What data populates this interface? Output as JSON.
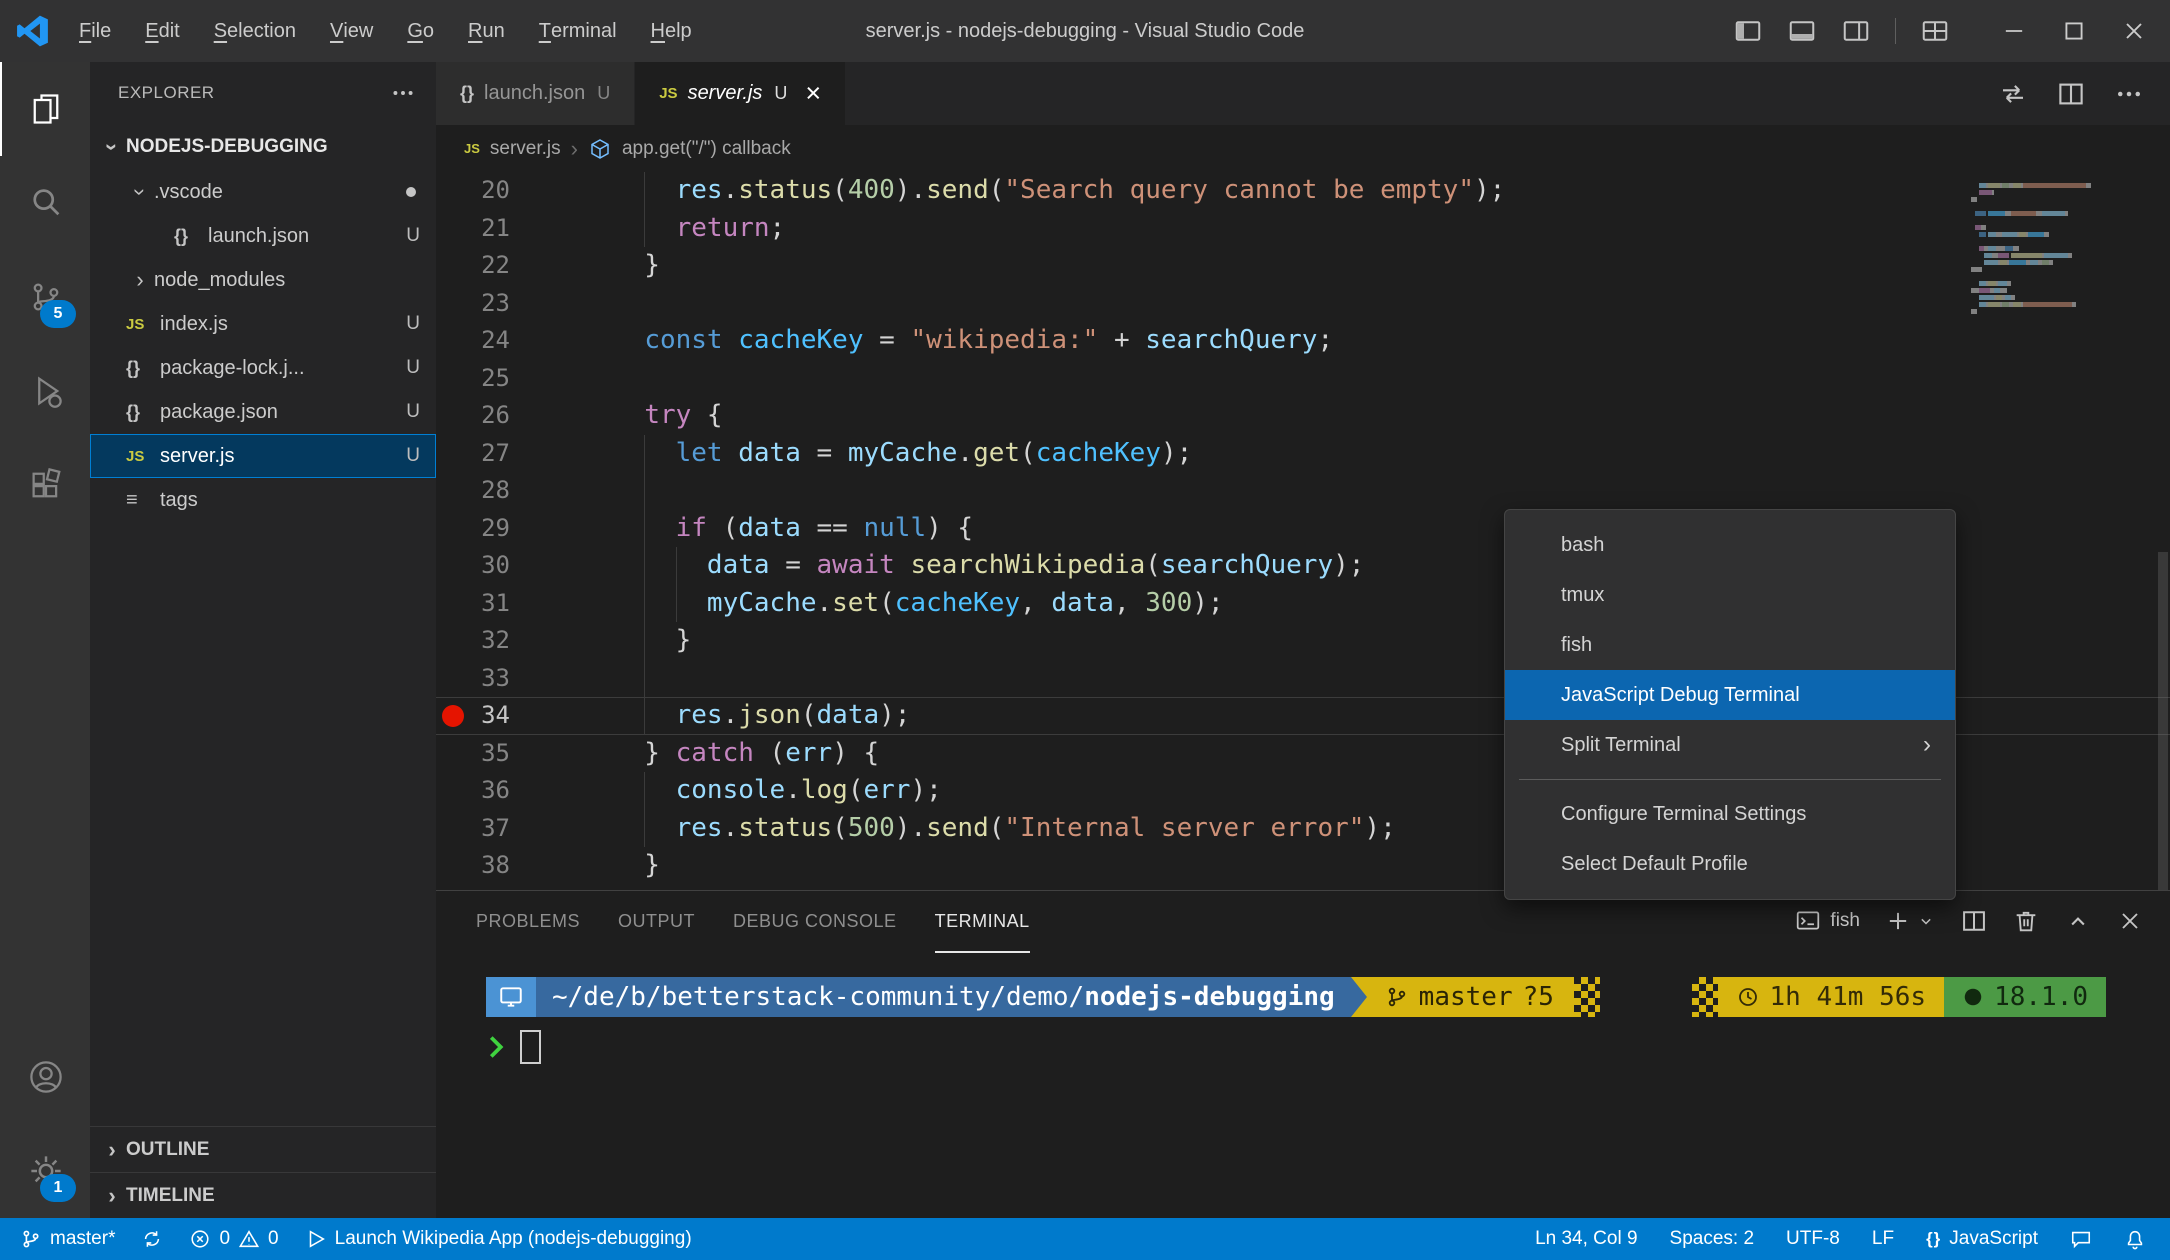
{
  "window": {
    "title": "server.js - nodejs-debugging - Visual Studio Code",
    "menus": [
      "File",
      "Edit",
      "Selection",
      "View",
      "Go",
      "Run",
      "Terminal",
      "Help"
    ]
  },
  "activity_bar": {
    "scm_badge": "5",
    "settings_badge": "1"
  },
  "sidebar": {
    "header": "EXPLORER",
    "root_label": "NODEJS-DEBUGGING",
    "files": [
      {
        "label": ".vscode",
        "kind": "folder",
        "chevron": "down",
        "indent": 1,
        "dot": true
      },
      {
        "label": "launch.json",
        "kind": "file",
        "icon": "json",
        "badge": "U",
        "indent": 2
      },
      {
        "label": "node_modules",
        "kind": "folder",
        "chevron": "right",
        "indent": 1
      },
      {
        "label": "index.js",
        "kind": "file",
        "icon": "js",
        "badge": "U",
        "indent": 1
      },
      {
        "label": "package-lock.j...",
        "kind": "file",
        "icon": "json",
        "badge": "U",
        "indent": 1
      },
      {
        "label": "package.json",
        "kind": "file",
        "icon": "json",
        "badge": "U",
        "indent": 1
      },
      {
        "label": "server.js",
        "kind": "file",
        "icon": "js",
        "badge": "U",
        "indent": 1,
        "selected": true
      },
      {
        "label": "tags",
        "kind": "file",
        "icon": "list",
        "indent": 1
      }
    ],
    "sections": [
      "OUTLINE",
      "TIMELINE"
    ]
  },
  "editor_tabs": [
    {
      "label": "launch.json",
      "icon": "json",
      "badge": "U",
      "active": false,
      "close": false,
      "italic": false
    },
    {
      "label": "server.js",
      "icon": "js",
      "badge": "U",
      "active": true,
      "close": true,
      "italic": true
    }
  ],
  "breadcrumb": {
    "file": "server.js",
    "symbol": "app.get(\"/\") callback"
  },
  "code": {
    "lines": [
      {
        "n": 20,
        "t": [
          [
            "p",
            "    "
          ],
          [
            "v",
            "res"
          ],
          [
            "p",
            "."
          ],
          [
            "f",
            "status"
          ],
          [
            "p",
            "("
          ],
          [
            "n",
            "400"
          ],
          [
            "p",
            ")."
          ],
          [
            "f",
            "send"
          ],
          [
            "p",
            "("
          ],
          [
            "s",
            "\"Search query cannot be empty\""
          ],
          [
            "p",
            ");"
          ]
        ]
      },
      {
        "n": 21,
        "t": [
          [
            "p",
            "    "
          ],
          [
            "k",
            "return"
          ],
          [
            "p",
            ";"
          ]
        ]
      },
      {
        "n": 22,
        "t": [
          [
            "p",
            "  }"
          ]
        ]
      },
      {
        "n": 23,
        "t": [
          [
            "p",
            "  "
          ]
        ]
      },
      {
        "n": 24,
        "t": [
          [
            "p",
            "  "
          ],
          [
            "d",
            "const"
          ],
          [
            "p",
            " "
          ],
          [
            "cv",
            "cacheKey"
          ],
          [
            "p",
            " = "
          ],
          [
            "s",
            "\"wikipedia:\""
          ],
          [
            "p",
            " + "
          ],
          [
            "v",
            "searchQuery"
          ],
          [
            "p",
            ";"
          ]
        ]
      },
      {
        "n": 25,
        "t": [
          [
            "p",
            "  "
          ]
        ]
      },
      {
        "n": 26,
        "t": [
          [
            "p",
            "  "
          ],
          [
            "k",
            "try"
          ],
          [
            "p",
            " {"
          ]
        ]
      },
      {
        "n": 27,
        "t": [
          [
            "p",
            "    "
          ],
          [
            "d",
            "let"
          ],
          [
            "p",
            " "
          ],
          [
            "v",
            "data"
          ],
          [
            "p",
            " = "
          ],
          [
            "v",
            "myCache"
          ],
          [
            "p",
            "."
          ],
          [
            "f",
            "get"
          ],
          [
            "p",
            "("
          ],
          [
            "cv",
            "cacheKey"
          ],
          [
            "p",
            ");"
          ]
        ]
      },
      {
        "n": 28,
        "t": [
          [
            "p",
            "    "
          ]
        ]
      },
      {
        "n": 29,
        "t": [
          [
            "p",
            "    "
          ],
          [
            "k",
            "if"
          ],
          [
            "p",
            " ("
          ],
          [
            "v",
            "data"
          ],
          [
            "p",
            " == "
          ],
          [
            "d",
            "null"
          ],
          [
            "p",
            ") {"
          ]
        ]
      },
      {
        "n": 30,
        "t": [
          [
            "p",
            "      "
          ],
          [
            "v",
            "data"
          ],
          [
            "p",
            " = "
          ],
          [
            "k",
            "await"
          ],
          [
            "p",
            " "
          ],
          [
            "f",
            "searchWikipedia"
          ],
          [
            "p",
            "("
          ],
          [
            "v",
            "searchQuery"
          ],
          [
            "p",
            ");"
          ]
        ]
      },
      {
        "n": 31,
        "t": [
          [
            "p",
            "      "
          ],
          [
            "v",
            "myCache"
          ],
          [
            "p",
            "."
          ],
          [
            "f",
            "set"
          ],
          [
            "p",
            "("
          ],
          [
            "cv",
            "cacheKey"
          ],
          [
            "p",
            ", "
          ],
          [
            "v",
            "data"
          ],
          [
            "p",
            ", "
          ],
          [
            "n",
            "300"
          ],
          [
            "p",
            ");"
          ]
        ]
      },
      {
        "n": 32,
        "t": [
          [
            "p",
            "    }"
          ]
        ]
      },
      {
        "n": 33,
        "t": [
          [
            "p",
            "    "
          ]
        ]
      },
      {
        "n": 34,
        "bp": true,
        "current": true,
        "t": [
          [
            "p",
            "    "
          ],
          [
            "v",
            "res"
          ],
          [
            "p",
            "."
          ],
          [
            "f",
            "json"
          ],
          [
            "p",
            "("
          ],
          [
            "v",
            "data"
          ],
          [
            "p",
            ");"
          ]
        ]
      },
      {
        "n": 35,
        "t": [
          [
            "p",
            "  } "
          ],
          [
            "k",
            "catch"
          ],
          [
            "p",
            " ("
          ],
          [
            "v",
            "err"
          ],
          [
            "p",
            ") {"
          ]
        ]
      },
      {
        "n": 36,
        "t": [
          [
            "p",
            "    "
          ],
          [
            "v",
            "console"
          ],
          [
            "p",
            "."
          ],
          [
            "f",
            "log"
          ],
          [
            "p",
            "("
          ],
          [
            "v",
            "err"
          ],
          [
            "p",
            ");"
          ]
        ]
      },
      {
        "n": 37,
        "t": [
          [
            "p",
            "    "
          ],
          [
            "v",
            "res"
          ],
          [
            "p",
            "."
          ],
          [
            "f",
            "status"
          ],
          [
            "p",
            "("
          ],
          [
            "n",
            "500"
          ],
          [
            "p",
            ")."
          ],
          [
            "f",
            "send"
          ],
          [
            "p",
            "("
          ],
          [
            "s",
            "\"Internal server error\""
          ],
          [
            "p",
            ");"
          ]
        ]
      },
      {
        "n": 38,
        "t": [
          [
            "p",
            "  }"
          ]
        ]
      }
    ]
  },
  "context_menu": {
    "items": [
      {
        "label": "bash"
      },
      {
        "label": "tmux"
      },
      {
        "label": "fish"
      },
      {
        "label": "JavaScript Debug Terminal",
        "selected": true
      },
      {
        "label": "Split Terminal",
        "submenu": true
      },
      {
        "separator": true
      },
      {
        "label": "Configure Terminal Settings"
      },
      {
        "label": "Select Default Profile"
      }
    ]
  },
  "panel": {
    "tabs": [
      {
        "label": "PROBLEMS"
      },
      {
        "label": "OUTPUT"
      },
      {
        "label": "DEBUG CONSOLE"
      },
      {
        "label": "TERMINAL",
        "active": true
      }
    ],
    "shell_label": "fish"
  },
  "terminal": {
    "path_prefix": "~/de/b/betterstack-community/demo/",
    "path_bold": "nodejs-debugging",
    "git_branch": "master",
    "git_status": "?5",
    "duration": "1h 41m 56s",
    "node_version": "18.1.0",
    "colors": {
      "icon_bg": "#4b93d4",
      "path_bg": "#37699f",
      "git_bg": "#d7b50f",
      "duration_bg": "#d7b50f",
      "node_bg": "#4c9a45"
    }
  },
  "status_bar": {
    "branch": "master*",
    "errors": "0",
    "warnings": "0",
    "debug_target": "Launch Wikipedia App (nodejs-debugging)",
    "line_col": "Ln 34, Col 9",
    "indentation": "Spaces: 2",
    "encoding": "UTF-8",
    "eol": "LF",
    "language": "JavaScript"
  },
  "theme": {
    "accent": "#007acc",
    "statusbar_bg": "#007acc",
    "breakpoint": "#e51400",
    "menu_selection": "#0c66b0",
    "selection_bg": "#04395e",
    "selection_border": "#007fd4",
    "syntax": {
      "keyword": "#c586c0",
      "storage": "#569cd6",
      "variable": "#9cdcfe",
      "const": "#4fc1ff",
      "function": "#dcdcaa",
      "string": "#ce9178",
      "number": "#b5cea8",
      "plain": "#d4d4d4"
    }
  }
}
